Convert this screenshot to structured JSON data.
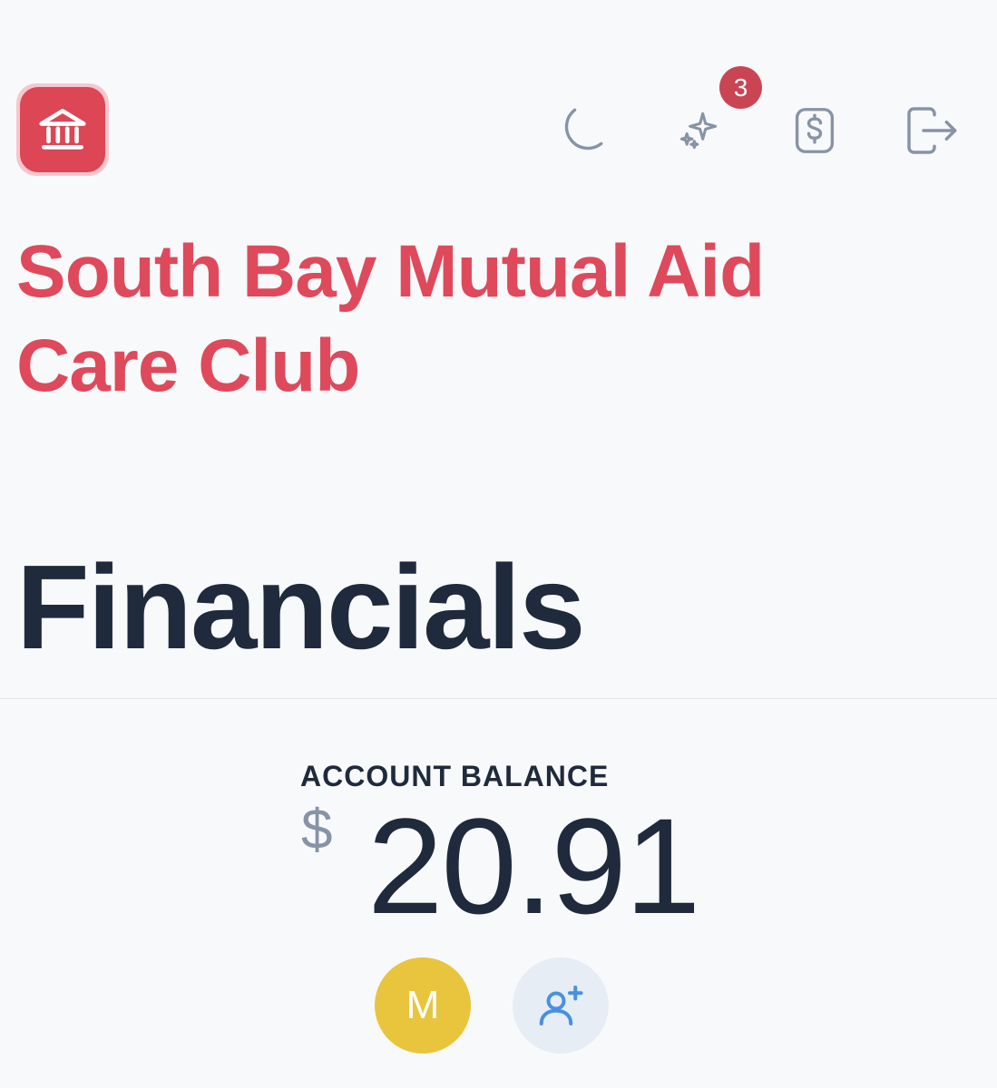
{
  "header": {
    "logo_icon": "bank-icon",
    "notification_count": "3",
    "icons": [
      "moon-icon",
      "sparkles-icon",
      "dollar-icon",
      "logout-icon"
    ]
  },
  "organization": {
    "name": "South Bay Mutual Aid Care Club"
  },
  "page": {
    "title": "Financials"
  },
  "balance": {
    "label": "ACCOUNT BALANCE",
    "currency": "$",
    "amount": "20.91"
  },
  "members": {
    "avatar_initial": "M",
    "add_icon": "add-user-icon"
  },
  "colors": {
    "brand": "#de4a5b",
    "text_dark": "#1f2a3c",
    "icon_gray": "#8793a6",
    "avatar": "#e8c53d",
    "badge": "#c94554"
  }
}
